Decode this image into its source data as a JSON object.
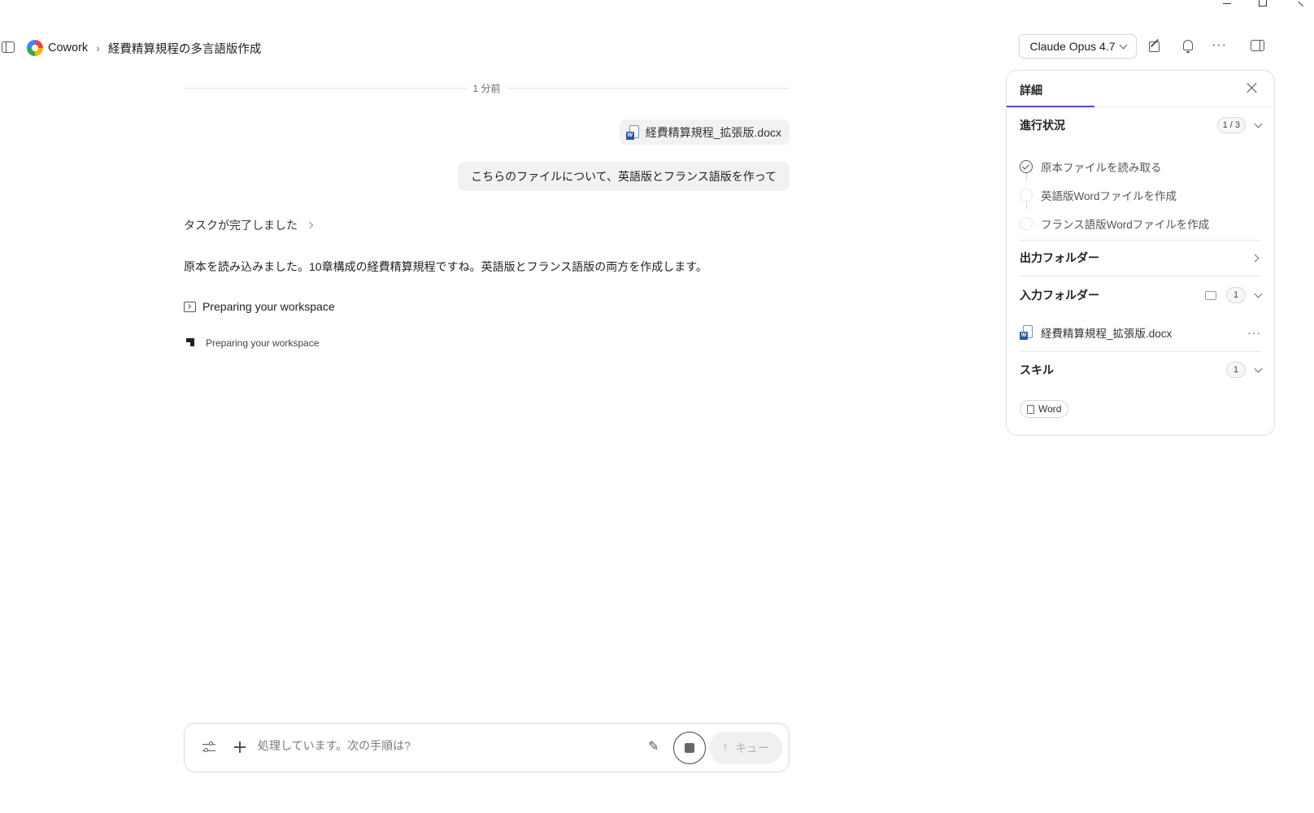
{
  "header": {
    "app_name": "Cowork",
    "breadcrumb_separator": "›",
    "task_title": "経費精算規程の多言語版作成",
    "model_label": "Claude Opus 4.7"
  },
  "chat": {
    "time_label": "1 分前",
    "attachment_name": "経費精算規程_拡張版.docx",
    "user_message": "こちらのファイルについて、英語版とフランス語版を作って",
    "task_status": "タスクが完了しました",
    "assistant_message": "原本を読み込みました。10章構成の経費精算規程ですね。英語版とフランス語版の両方を作成します。",
    "tool_label": "Preparing your workspace",
    "status_label": "Preparing your workspace"
  },
  "composer": {
    "placeholder": "処理しています。次の手順は?",
    "queue_label": "キュー"
  },
  "detail_panel": {
    "tab_label": "詳細",
    "progress": {
      "title": "進行状況",
      "count": "1 / 3",
      "steps": [
        {
          "label": "原本ファイルを読み取る",
          "status": "done"
        },
        {
          "label": "英語版Wordファイルを作成",
          "status": "pending"
        },
        {
          "label": "フランス語版Wordファイルを作成",
          "status": "pending"
        }
      ]
    },
    "output_folder": {
      "title": "出力フォルダー"
    },
    "input_folder": {
      "title": "入力フォルダー",
      "count": "1",
      "file_name": "経費精算規程_拡張版.docx"
    },
    "skills": {
      "title": "スキル",
      "count": "1",
      "chip_label": "Word"
    }
  },
  "colors": {
    "accent": "#4b4bd8",
    "bubble_bg": "#f2f2f2",
    "word_blue": "#2b579a"
  }
}
